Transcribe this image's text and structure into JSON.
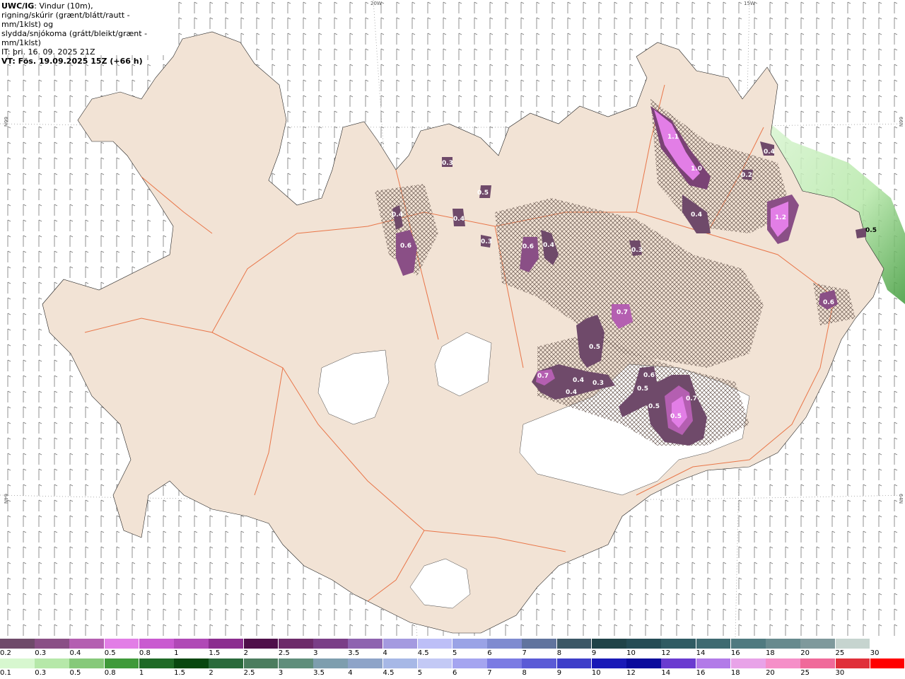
{
  "title": {
    "code": "UWC/IG",
    "line1": ": Vindur (10m),",
    "line2": "rigning/skúrir (grænt/blátt/rautt - mm/1klst) og",
    "line3": "slydda/snjókoma (grátt/bleikt/grænt - mm/1klst)",
    "it": "IT: þri. 16. 09. 2025 21Z",
    "vt": "VT: Fös. 19.09.2025 15Z (+66 h)"
  },
  "graticule": {
    "lon_labels": [
      "20W",
      "15W"
    ],
    "lat_labels": [
      "66N",
      "64N"
    ]
  },
  "colors": {
    "land": "#f2e3d5",
    "roads": "#e86a3a",
    "glacier": "#ffffff",
    "sea": "#ffffff",
    "wind_barb": "#777777",
    "snow_hatch": "#6b5a52"
  },
  "precip_labels": [
    {
      "value": "1.1",
      "type": "snow"
    },
    {
      "value": "1.0",
      "type": "snow"
    },
    {
      "value": "0.4",
      "type": "snow"
    },
    {
      "value": "1.2",
      "type": "snow"
    },
    {
      "value": "0.2",
      "type": "snow"
    },
    {
      "value": "0.4",
      "type": "snow"
    },
    {
      "value": "0.5",
      "type": "rain"
    },
    {
      "value": "0.6",
      "type": "snow"
    },
    {
      "value": "0.7",
      "type": "snow"
    },
    {
      "value": "0.5",
      "type": "snow"
    },
    {
      "value": "0.4",
      "type": "snow"
    },
    {
      "value": "0.4",
      "type": "snow"
    },
    {
      "value": "0.3",
      "type": "snow"
    },
    {
      "value": "0.7",
      "type": "snow"
    },
    {
      "value": "0.6",
      "type": "snow"
    },
    {
      "value": "0.5",
      "type": "snow"
    },
    {
      "value": "0.5",
      "type": "snow"
    },
    {
      "value": "0.7",
      "type": "snow"
    },
    {
      "value": "0.6",
      "type": "snow"
    },
    {
      "value": "0.5",
      "type": "snow"
    },
    {
      "value": "0.4",
      "type": "snow"
    },
    {
      "value": "0.3",
      "type": "snow"
    },
    {
      "value": "0.6",
      "type": "snow"
    },
    {
      "value": "0.4",
      "type": "snow"
    },
    {
      "value": "0.4",
      "type": "snow"
    },
    {
      "value": "0.3",
      "type": "snow"
    },
    {
      "value": "0.5",
      "type": "snow"
    },
    {
      "value": "0.3",
      "type": "snow"
    }
  ],
  "colorbar_snow": {
    "labels": [
      "0.2",
      "0.3",
      "0.4",
      "0.5",
      "0.8",
      "1",
      "1.5",
      "2",
      "2.5",
      "3",
      "3.5",
      "4",
      "4.5",
      "5",
      "6",
      "7",
      "8",
      "9",
      "10",
      "12",
      "14",
      "16",
      "18",
      "20",
      "25",
      "30"
    ],
    "colors": [
      "#6f4a6a",
      "#8a4f86",
      "#b45fb1",
      "#e27ee6",
      "#c95ad0",
      "#b049b6",
      "#8b2d8f",
      "#4f0f4a",
      "#6d2b6a",
      "#7a3e87",
      "#8e63b0",
      "#a49ae0",
      "#bdbff7",
      "#9aa3e6",
      "#7f8bd0",
      "#61749e",
      "#3b5766",
      "#1f4348",
      "#244c55",
      "#2f5b63",
      "#3e6a71",
      "#4f7a80",
      "#678a8e",
      "#7f999c",
      "#c6d4cf",
      "#ffffff"
    ]
  },
  "colorbar_rain": {
    "labels": [
      "0.1",
      "0.3",
      "0.5",
      "0.8",
      "1",
      "1.5",
      "2",
      "2.5",
      "3",
      "3.5",
      "4",
      "4.5",
      "5",
      "6",
      "7",
      "8",
      "9",
      "10",
      "12",
      "14",
      "16",
      "18",
      "20",
      "25",
      "30"
    ],
    "colors": [
      "#d7f7cf",
      "#b6e8a9",
      "#86c97a",
      "#3f9a3a",
      "#1f6a26",
      "#08470f",
      "#2a6a3b",
      "#4b7d5e",
      "#5f8e7b",
      "#7e9eae",
      "#8ea4c8",
      "#a7b8e6",
      "#c3c9f5",
      "#a5a5f0",
      "#7b7be3",
      "#5b5bd6",
      "#3e3ec9",
      "#1a1ab7",
      "#0a0a9c",
      "#6a3bd0",
      "#b27be8",
      "#e8a3e8",
      "#f58fc8",
      "#f06a9a",
      "#e0303a",
      "#ff0000"
    ]
  }
}
